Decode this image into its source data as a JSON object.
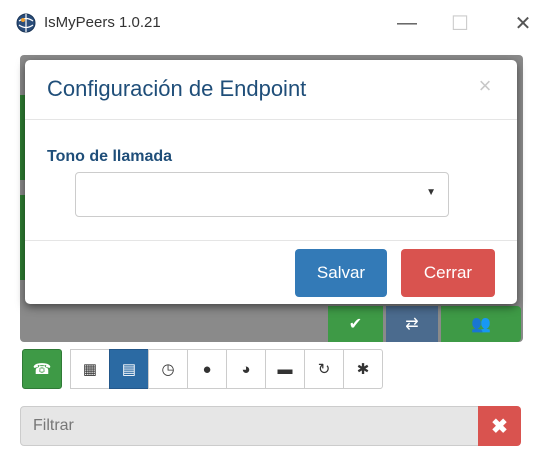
{
  "window": {
    "title": "IsMyPeers 1.0.21",
    "minimize_icon": "—",
    "maximize_icon": "☐",
    "close_icon": "✕"
  },
  "modal": {
    "title": "Configuración de Endpoint",
    "close_icon": "×",
    "field_label": "Tono de llamada",
    "select_value": "",
    "save_label": "Salvar",
    "cancel_label": "Cerrar"
  },
  "actions": {
    "check_icon": "✔",
    "transfer_icon": "⇄",
    "group_icon": "👥"
  },
  "toolbar": {
    "items": [
      {
        "name": "phone-icon",
        "glyph": "☎"
      },
      {
        "name": "keypad-icon",
        "glyph": "▦"
      },
      {
        "name": "list-icon",
        "glyph": "▤"
      },
      {
        "name": "clock-icon",
        "glyph": "◷"
      },
      {
        "name": "user-icon",
        "glyph": "●"
      },
      {
        "name": "globe-icon",
        "glyph": "◕"
      },
      {
        "name": "chat-icon",
        "glyph": "▬"
      },
      {
        "name": "share-icon",
        "glyph": "↻"
      },
      {
        "name": "settings-icon",
        "glyph": "✱"
      }
    ]
  },
  "filter": {
    "placeholder": "Filtrar",
    "clear_icon": "✖"
  },
  "colors": {
    "primary": "#337ab7",
    "danger": "#d9534f",
    "success": "#3e9a46",
    "title_blue": "#1f4e79"
  }
}
